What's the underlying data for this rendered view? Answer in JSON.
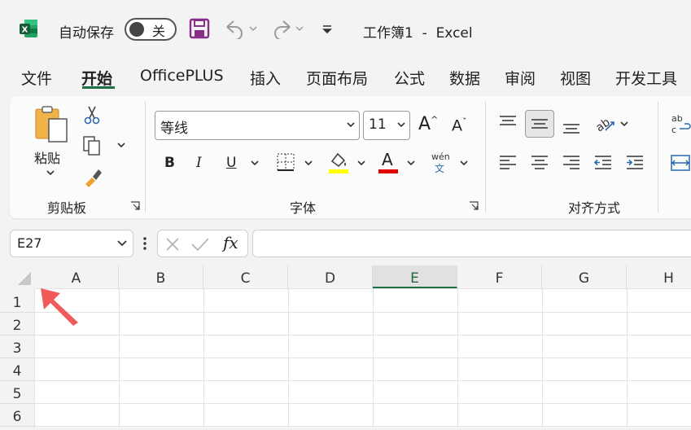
{
  "titlebar": {
    "autosave_label": "自动保存",
    "autosave_state": "关",
    "title": "工作簿1  -  Excel",
    "icons": [
      "excel-logo-icon",
      "save-icon",
      "undo-icon",
      "redo-icon",
      "customize-qat-icon"
    ]
  },
  "tabs": [
    {
      "label": "文件"
    },
    {
      "label": "开始"
    },
    {
      "label": "OfficePLUS"
    },
    {
      "label": "插入"
    },
    {
      "label": "页面布局"
    },
    {
      "label": "公式"
    },
    {
      "label": "数据"
    },
    {
      "label": "审阅"
    },
    {
      "label": "视图"
    },
    {
      "label": "开发工具"
    }
  ],
  "active_tab": "开始",
  "ribbon": {
    "clipboard": {
      "paste_label": "粘贴",
      "group_label": "剪贴板"
    },
    "font": {
      "font_name": "等线",
      "font_size": "11",
      "bold": "B",
      "italic": "I",
      "underline": "U",
      "font_color_glyph": "A",
      "phonetic_top": "wén",
      "phonetic_bottom": "文",
      "grow_glyph": "A",
      "shrink_glyph": "A",
      "group_label": "字体"
    },
    "alignment": {
      "group_label": "对齐方式"
    },
    "colors": {
      "highlight": "#ffff00",
      "font_color": "#e00000",
      "accent": "#1e7145"
    }
  },
  "formula_bar": {
    "name_box": "E27",
    "fx_label": "fx",
    "formula": ""
  },
  "grid": {
    "columns": [
      "A",
      "B",
      "C",
      "D",
      "E",
      "F",
      "G",
      "H"
    ],
    "selected_column": "E",
    "rows": [
      "1",
      "2",
      "3",
      "4",
      "5",
      "6"
    ]
  }
}
